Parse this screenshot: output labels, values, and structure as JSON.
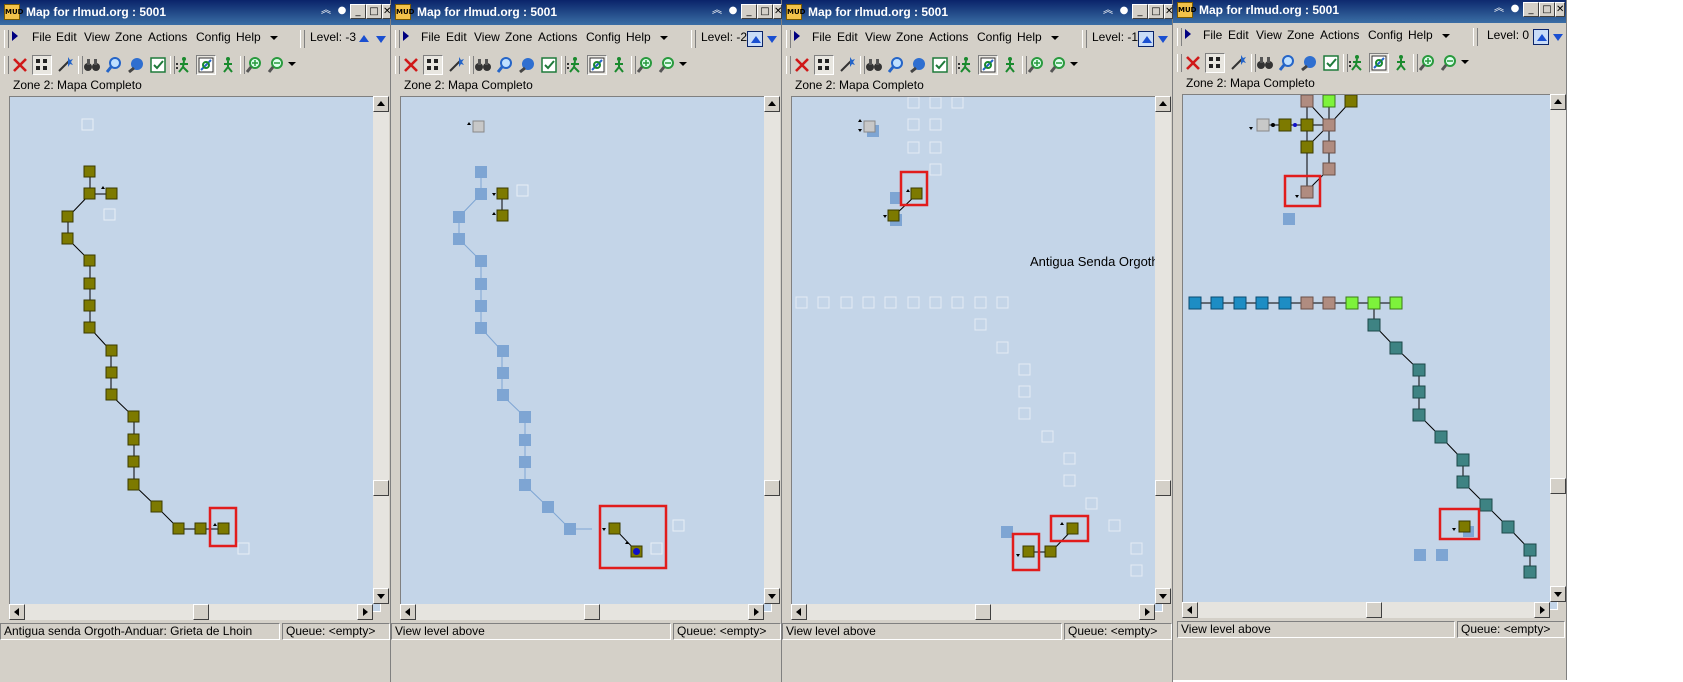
{
  "colors": {
    "map_bg": "#c4d5e8",
    "room_current": "#7d7a00",
    "room_below": "#7ea5d3",
    "room_faint": "#e4ecf5",
    "room_brown": "#b08c80",
    "room_teal": "#3e8383",
    "room_blue": "#1d8dc4",
    "room_green": "#7df33b",
    "highlight": "#e11c1c"
  },
  "windows": [
    {
      "title": "Map for rlmud.org : 5001",
      "menu": [
        "File",
        "Edit",
        "View",
        "Zone",
        "Actions",
        "Config",
        "Help"
      ],
      "level": "Level: -3",
      "zone": "Zone 2: Mapa Completo",
      "status": "Antigua senda Orgoth-Anduar: Grieta de Lhoin",
      "queue": "Queue:  <empty>",
      "map_text": ""
    },
    {
      "title": "Map for rlmud.org : 5001",
      "menu": [
        "File",
        "Edit",
        "View",
        "Zone",
        "Actions",
        "Config",
        "Help"
      ],
      "level": "Level: -2",
      "zone": "Zone 2: Mapa Completo",
      "status": "View level above",
      "queue": "Queue:  <empty>",
      "map_text": ""
    },
    {
      "title": "Map for rlmud.org : 5001",
      "menu": [
        "File",
        "Edit",
        "View",
        "Zone",
        "Actions",
        "Config",
        "Help"
      ],
      "level": "Level: -1",
      "zone": "Zone 2: Mapa Completo",
      "status": "View level above",
      "queue": "Queue:  <empty>",
      "map_text": "Antigua Senda Orgoth-A"
    },
    {
      "title": "Map for rlmud.org : 5001",
      "menu": [
        "File",
        "Edit",
        "View",
        "Zone",
        "Actions",
        "Config",
        "Help"
      ],
      "level": "Level: 0",
      "zone": "Zone 2: Mapa Completo",
      "status": "View level above",
      "queue": "Queue:  <empty>",
      "map_text": ""
    }
  ],
  "icons": [
    "close-icon",
    "grid-icon",
    "wand-icon",
    "binoculars-icon",
    "find-icon",
    "globe-icon",
    "check-icon",
    "walker-icon",
    "map-walk-icon",
    "person-icon",
    "zoom-in-icon",
    "zoom-out-icon"
  ]
}
